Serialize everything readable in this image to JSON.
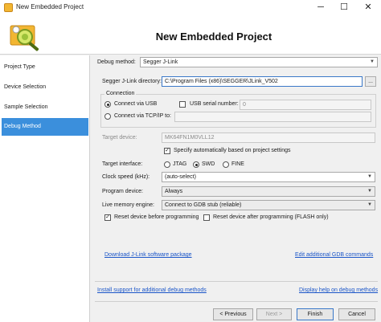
{
  "window": {
    "title": "New Embedded Project",
    "minimize_glyph": "─",
    "maximize_glyph": "☐",
    "close_glyph": "✕"
  },
  "header": {
    "title": "New Embedded Project"
  },
  "sidebar": {
    "items": [
      {
        "label": "Project Type"
      },
      {
        "label": "Device Selection"
      },
      {
        "label": "Sample Selection"
      },
      {
        "label": "Debug Method"
      }
    ]
  },
  "form": {
    "debug_method_label": "Debug method:",
    "debug_method_value": "Segger J-Link",
    "jlink_dir_label": "Segger J-Link directory:",
    "jlink_dir_value": "C:\\Program Files (x86)\\SEGGER\\JLink_V502",
    "browse_label": "...",
    "connection_group_label": "Connection",
    "connect_usb_label": "Connect via USB",
    "usb_serial_label": "USB serial number:",
    "usb_serial_value": "0",
    "connect_tcp_label": "Connect via TCP/IP to:",
    "tcp_value": "",
    "target_device_label": "Target device:",
    "target_device_value": "MK64FN1M0VLL12",
    "specify_auto_label": "Specify automatically based on project settings",
    "target_interface_label": "Target interface:",
    "iface_jtag": "JTAG",
    "iface_swd": "SWD",
    "iface_fine": "FINE",
    "clock_speed_label": "Clock speed (kHz):",
    "clock_speed_value": "(auto-select)",
    "program_device_label": "Program device:",
    "program_device_value": "Always",
    "live_memory_label": "Live memory engine:",
    "live_memory_value": "Connect to GDB stub (reliable)",
    "reset_before_label": "Reset device before programming",
    "reset_after_label": "Reset device after programming (FLASH only)",
    "download_link": "Download J-Link software package",
    "edit_gdb_link": "Edit additional GDB commands",
    "install_support_link": "Install support for additional debug methods",
    "display_help_link": "Display help on debug methods",
    "checkmark_glyph": "✓",
    "dropdown_glyph": "▼"
  },
  "footer": {
    "previous_label": "< Previous",
    "next_label": "Next >",
    "finish_label": "Finish",
    "cancel_label": "Cancel"
  }
}
